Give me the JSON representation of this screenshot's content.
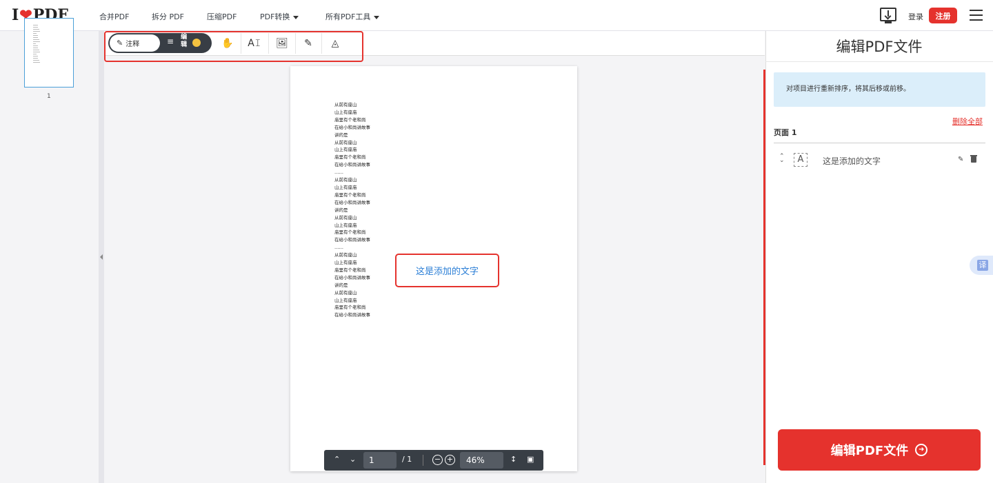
{
  "header": {
    "logo_i": "I",
    "logo_heart": "❤",
    "logo_pdf": "PDF",
    "nav": [
      {
        "label": "合并PDF"
      },
      {
        "label": "拆分 PDF"
      },
      {
        "label": "压缩PDF"
      },
      {
        "label": "PDF转换"
      },
      {
        "label": "所有PDF工具"
      }
    ],
    "login_label": "登录",
    "signup_label": "注册"
  },
  "sidebar": {
    "thumbnail_page_number": "1"
  },
  "toolbar": {
    "annotate_label": "注释",
    "edit_label": "编辑"
  },
  "document": {
    "lines": [
      "从前有座山",
      "山上有座庙",
      "庙里有个老和尚",
      "在给小和尚讲故事",
      "讲的是",
      "从前有座山",
      "山上有座庙",
      "庙里有个老和尚",
      "在给小和尚讲故事",
      "……",
      "从前有座山",
      "山上有座庙",
      "庙里有个老和尚",
      "在给小和尚讲故事",
      "讲的是",
      "从前有座山",
      "山上有座庙",
      "庙里有个老和尚",
      "在给小和尚讲故事",
      "……",
      "从前有座山",
      "山上有座庙",
      "庙里有个老和尚",
      "在给小和尚讲故事",
      "讲的是",
      "从前有座山",
      "山上有座庙",
      "庙里有个老和尚",
      "在给小和尚讲故事"
    ],
    "added_text": "这是添加的文字"
  },
  "pager": {
    "current_page": "1",
    "total_pages": "/ 1",
    "zoom": "46%"
  },
  "panel": {
    "title": "编辑PDF文件",
    "info": "对项目进行重新排序，将其后移或前移。",
    "delete_all": "删除全部",
    "page_label": "页面 1",
    "item_text": "这是添加的文字",
    "translate_label": "译",
    "main_button": "编辑PDF文件"
  },
  "colors": {
    "brand_red": "#e5322d",
    "added_text_blue": "#2a7ed6",
    "info_bg": "#dbeefa"
  }
}
